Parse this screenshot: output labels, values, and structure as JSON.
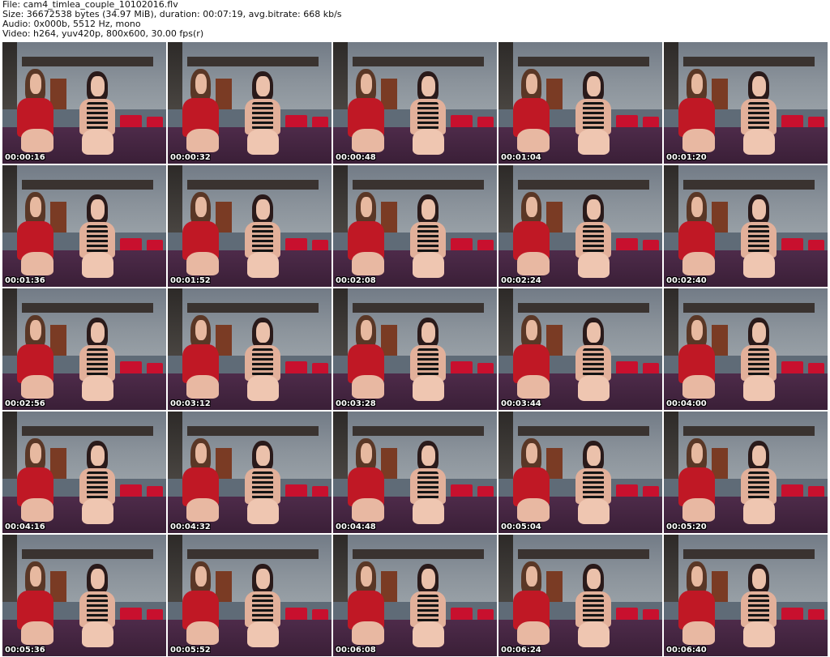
{
  "header": {
    "file_line": "File: cam4_timlea_couple_10102016.flv",
    "size_line": "Size: 36672538 bytes (34.97 MiB), duration: 00:07:19, avg.bitrate: 668 kb/s",
    "audio_line": "Audio: 0x000b, 5512 Hz, mono",
    "video_line": "Video: h264, yuv420p, 800x600, 30.00 fps(r)"
  },
  "colors": {
    "dress_red": "#c01825",
    "pillow_red": "#c8102e",
    "bedspread_purple": "#4e2b4a",
    "wall_gray": "#8b939b"
  },
  "thumbnails": [
    {
      "timestamp": "00:00:16"
    },
    {
      "timestamp": "00:00:32"
    },
    {
      "timestamp": "00:00:48"
    },
    {
      "timestamp": "00:01:04"
    },
    {
      "timestamp": "00:01:20"
    },
    {
      "timestamp": "00:01:36"
    },
    {
      "timestamp": "00:01:52"
    },
    {
      "timestamp": "00:02:08"
    },
    {
      "timestamp": "00:02:24"
    },
    {
      "timestamp": "00:02:40"
    },
    {
      "timestamp": "00:02:56"
    },
    {
      "timestamp": "00:03:12"
    },
    {
      "timestamp": "00:03:28"
    },
    {
      "timestamp": "00:03:44"
    },
    {
      "timestamp": "00:04:00"
    },
    {
      "timestamp": "00:04:16"
    },
    {
      "timestamp": "00:04:32"
    },
    {
      "timestamp": "00:04:48"
    },
    {
      "timestamp": "00:05:04"
    },
    {
      "timestamp": "00:05:20"
    },
    {
      "timestamp": "00:05:36"
    },
    {
      "timestamp": "00:05:52"
    },
    {
      "timestamp": "00:06:08"
    },
    {
      "timestamp": "00:06:24"
    },
    {
      "timestamp": "00:06:40"
    }
  ]
}
